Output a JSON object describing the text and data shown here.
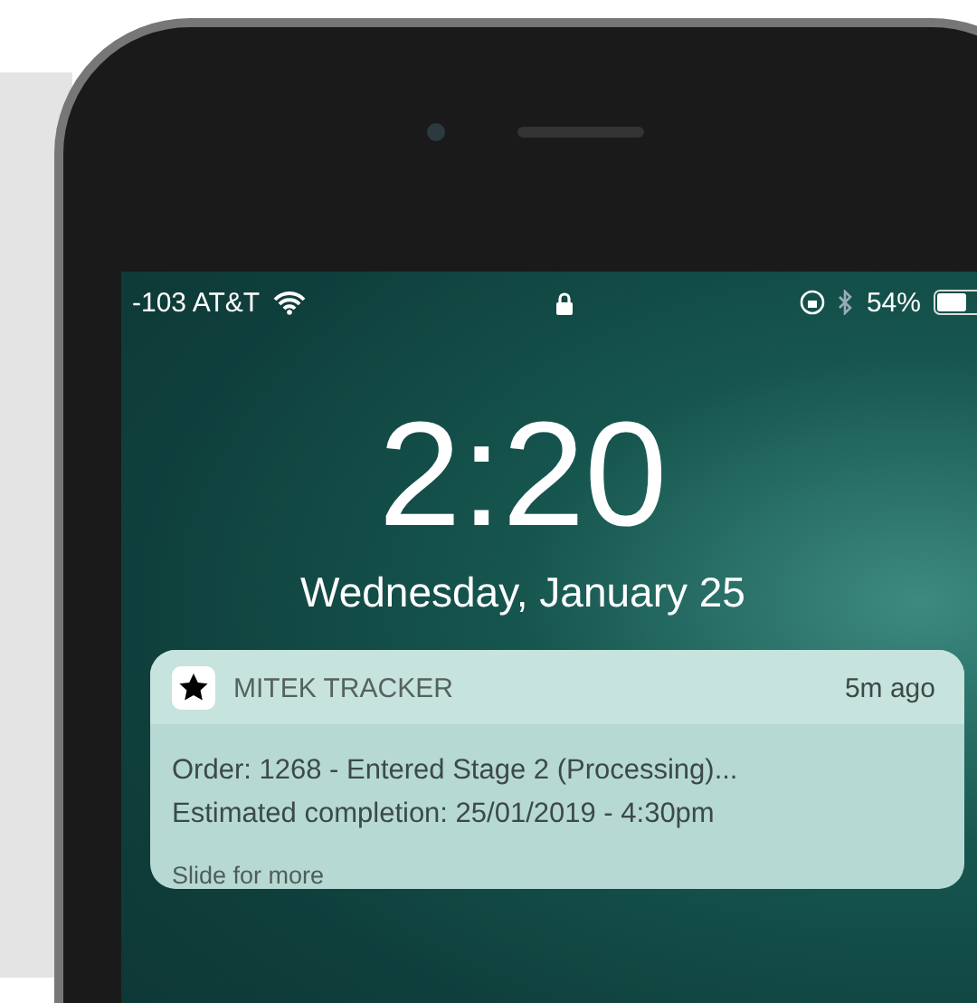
{
  "status_bar": {
    "carrier": "-103 AT&T",
    "battery": "54%"
  },
  "lock_screen": {
    "time": "2:20",
    "date": "Wednesday, January 25"
  },
  "notification": {
    "app": "MITEK TRACKER",
    "age": "5m ago",
    "lines": [
      "Order: 1268 - Entered Stage 2 (Processing)...",
      "Estimated completion: 25/01/2019 - 4:30pm"
    ],
    "hint": "Slide for more"
  }
}
